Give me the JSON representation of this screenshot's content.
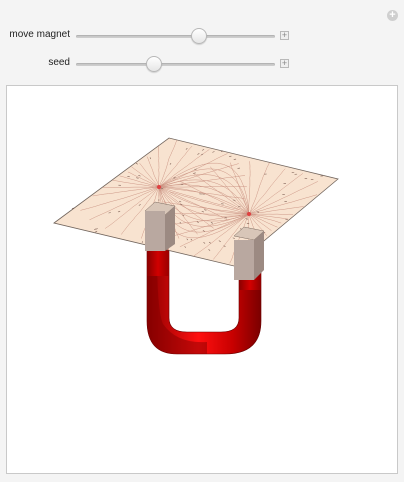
{
  "controls": {
    "move_magnet": {
      "label": "move magnet",
      "value": 0.62
    },
    "seed": {
      "label": "seed",
      "value": 0.39
    },
    "expand_symbol": "+",
    "increment_symbol": "+"
  },
  "visualization": {
    "magnet_color": "#c40000",
    "magnet_highlight": "#ff1a1a",
    "plane_color": "#f7dcc4",
    "field_line_color": "#c08070",
    "pole_color": "#e04040"
  }
}
